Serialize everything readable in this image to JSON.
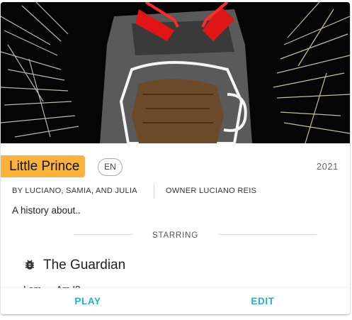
{
  "story": {
    "title": "Little Prince",
    "language": "EN",
    "year": "2021",
    "authors": "BY LUCIANO, SAMIA, AND JULIA",
    "owner": "OWNER LUCIANO REIS",
    "description": "A history about.."
  },
  "starring": {
    "label": "STARRING",
    "character": {
      "name": "The Guardian",
      "icon": "bug-icon",
      "line": "I am .... Am I?"
    }
  },
  "actions": {
    "play_label": "PLAY",
    "edit_label": "EDIT"
  },
  "colors": {
    "title_badge": "#fbb23a",
    "action": "#29a8d8"
  }
}
